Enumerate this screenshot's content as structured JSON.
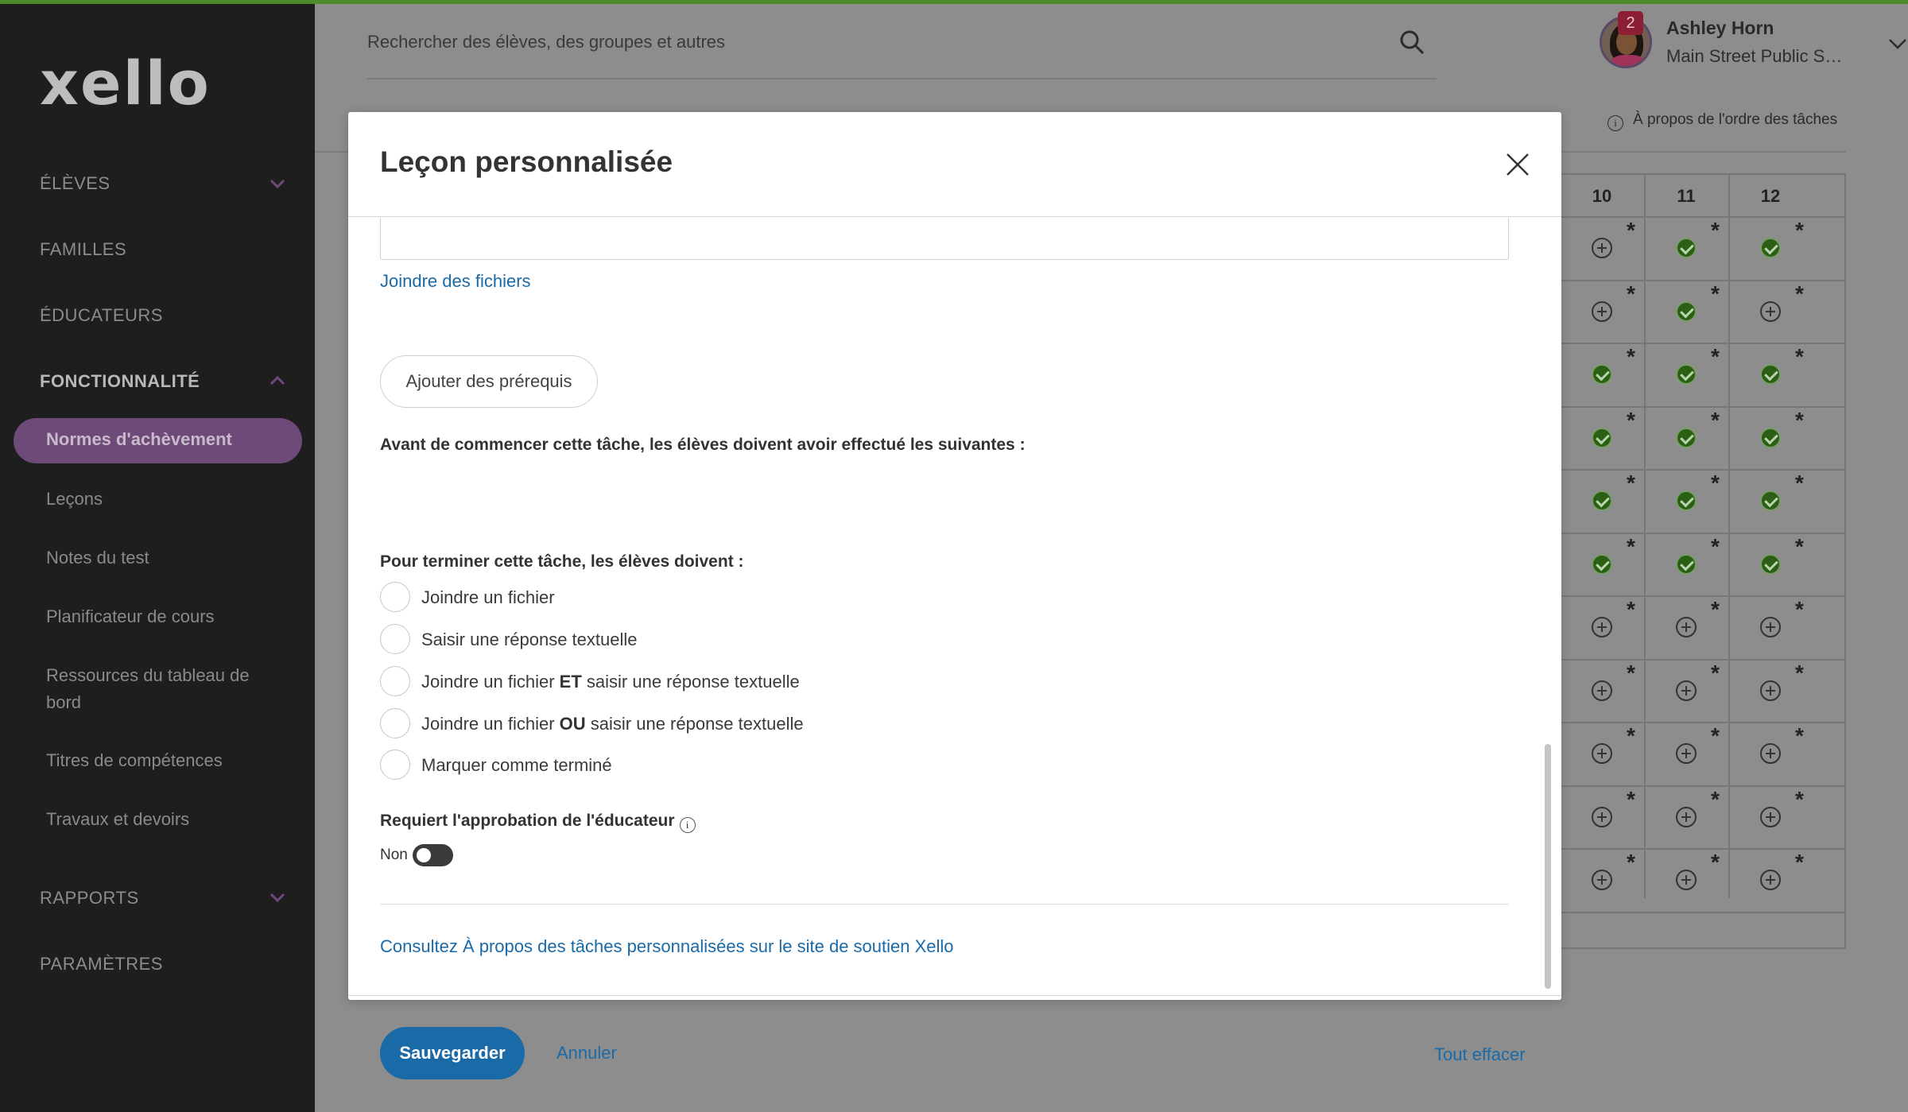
{
  "colors": {
    "accent_blue": "#1a6aa8",
    "sidebar_bg": "#1e1e1e",
    "active_nav": "#6e4a78",
    "check_green": "#2b5f14",
    "top_accent": "#4d8a2a",
    "badge_red": "#8c1f33"
  },
  "brand": {
    "logo_text": "xello"
  },
  "sidebar": {
    "sections": {
      "students": "ÉLÈVES",
      "families": "FAMILLES",
      "educators": "ÉDUCATEURS",
      "features": "FONCTIONNALITÉ",
      "reports": "RAPPORTS",
      "settings": "PARAMÈTRES"
    },
    "items": {
      "completion_standards": "Normes d'achèvement",
      "lessons": "Leçons",
      "test_scores": "Notes du test",
      "course_planner": "Planificateur de cours",
      "dashboard_resources": "Ressources du tableau de bord",
      "skill_titles": "Titres de compétences",
      "assignments": "Travaux et devoirs"
    }
  },
  "header": {
    "search_placeholder": "Rechercher des élèves, des groupes et autres",
    "user_name": "Ashley Horn",
    "user_school": "Main Street Public Scho...",
    "notification_count": "2",
    "about_task_order": "À propos de l'ordre des tâches",
    "info_icon_glyph": "i"
  },
  "grid": {
    "columns": [
      "10",
      "11",
      "12"
    ],
    "rows": [
      [
        "plus",
        "check",
        "check"
      ],
      [
        "plus",
        "check",
        "plus"
      ],
      [
        "check",
        "check",
        "check"
      ],
      [
        "check",
        "check",
        "check"
      ],
      [
        "check",
        "check",
        "check"
      ],
      [
        "check",
        "check",
        "check"
      ],
      [
        "plus",
        "plus",
        "plus"
      ],
      [
        "plus",
        "plus",
        "plus"
      ],
      [
        "plus",
        "plus",
        "plus"
      ],
      [
        "plus",
        "plus",
        "plus"
      ],
      [
        "plus",
        "plus",
        "plus"
      ]
    ],
    "star_glyph": "*"
  },
  "modal": {
    "title": "Leçon personnalisée",
    "attach_files_link": "Joindre des fichiers",
    "prereq_label": "Avant de commencer cette tâche, les élèves doivent avoir effectué les suivantes :",
    "prereq_button": "Ajouter des prérequis",
    "completion_label": "Pour terminer cette tâche, les élèves doivent :",
    "options": {
      "attach_file": "Joindre un fichier",
      "text_response": "Saisir une réponse textuelle",
      "attach_prefix": "Joindre un fichier ",
      "and_word": "ET",
      "or_word": "OU",
      "text_suffix": " saisir une réponse textuelle",
      "mark_complete": "Marquer comme terminé"
    },
    "approval_label": "Requiert l'approbation de l'éducateur",
    "approval_info_glyph": "i",
    "approval_toggle_label": "Non",
    "support_link": "Consultez À propos des tâches personnalisées sur le site de soutien Xello",
    "save_button": "Sauvegarder",
    "cancel_link": "Annuler",
    "clear_all_link": "Tout effacer"
  }
}
